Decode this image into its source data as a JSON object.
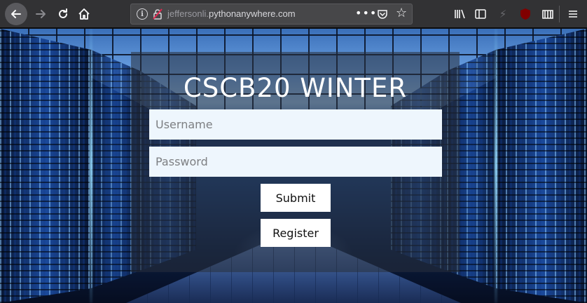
{
  "browser": {
    "url_subdomain": "jeffersonli.",
    "url_domain": "pythonanywhere.com",
    "url_dots": "•••",
    "icons": {
      "back": "back-arrow-icon",
      "forward": "forward-arrow-icon",
      "reload": "reload-icon",
      "home": "home-icon",
      "info": "info-icon",
      "insecure": "insecure-lock-icon",
      "page_actions": "more-dots-icon",
      "pocket": "pocket-icon",
      "bookmark": "star-icon",
      "library": "library-icon",
      "sidebar": "sidebar-icon",
      "flash": "flash-icon",
      "ublock": "ublock-origin-icon",
      "extension": "extension-icon",
      "menu": "hamburger-menu-icon"
    },
    "ublock_badge": "uD"
  },
  "page": {
    "title": "CSCB20 WINTER",
    "username_placeholder": "Username",
    "password_placeholder": "Password",
    "submit_label": "Submit",
    "register_label": "Register"
  },
  "colors": {
    "toolbar_bg": "#323234",
    "urlbar_bg": "#474749",
    "field_bg": "#eef6fd",
    "button_bg": "#ffffff",
    "title_color": "#ffffff"
  }
}
